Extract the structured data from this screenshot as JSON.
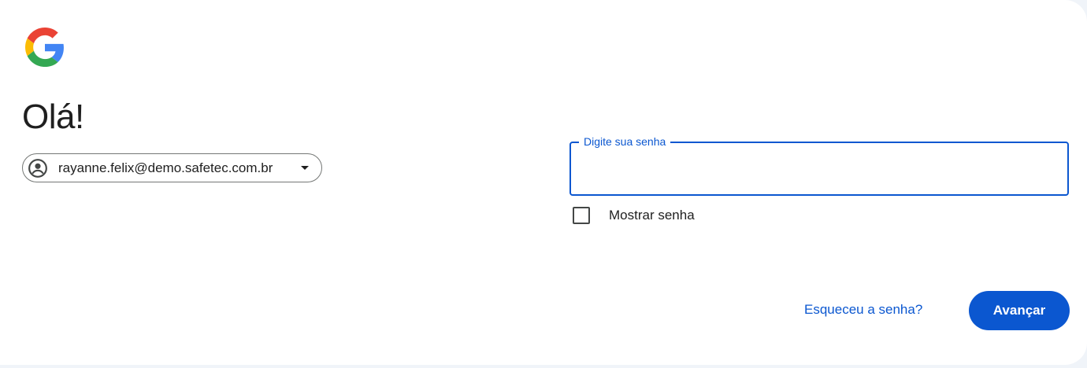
{
  "header": {
    "logo_icon": "google-g-logo",
    "greeting": "Olá!"
  },
  "account": {
    "email": "rayanne.felix@demo.safetec.com.br",
    "avatar_icon": "account-circle-icon",
    "dropdown_icon": "caret-down-icon"
  },
  "password": {
    "label": "Digite sua senha",
    "value": "",
    "show_password_label": "Mostrar senha",
    "show_password_checked": false
  },
  "actions": {
    "forgot_label": "Esqueceu a senha?",
    "next_label": "Avançar"
  },
  "colors": {
    "primary": "#0b57d0",
    "text": "#1f1f1f",
    "outline": "#747775",
    "background": "#f0f4f9",
    "card": "#ffffff"
  }
}
